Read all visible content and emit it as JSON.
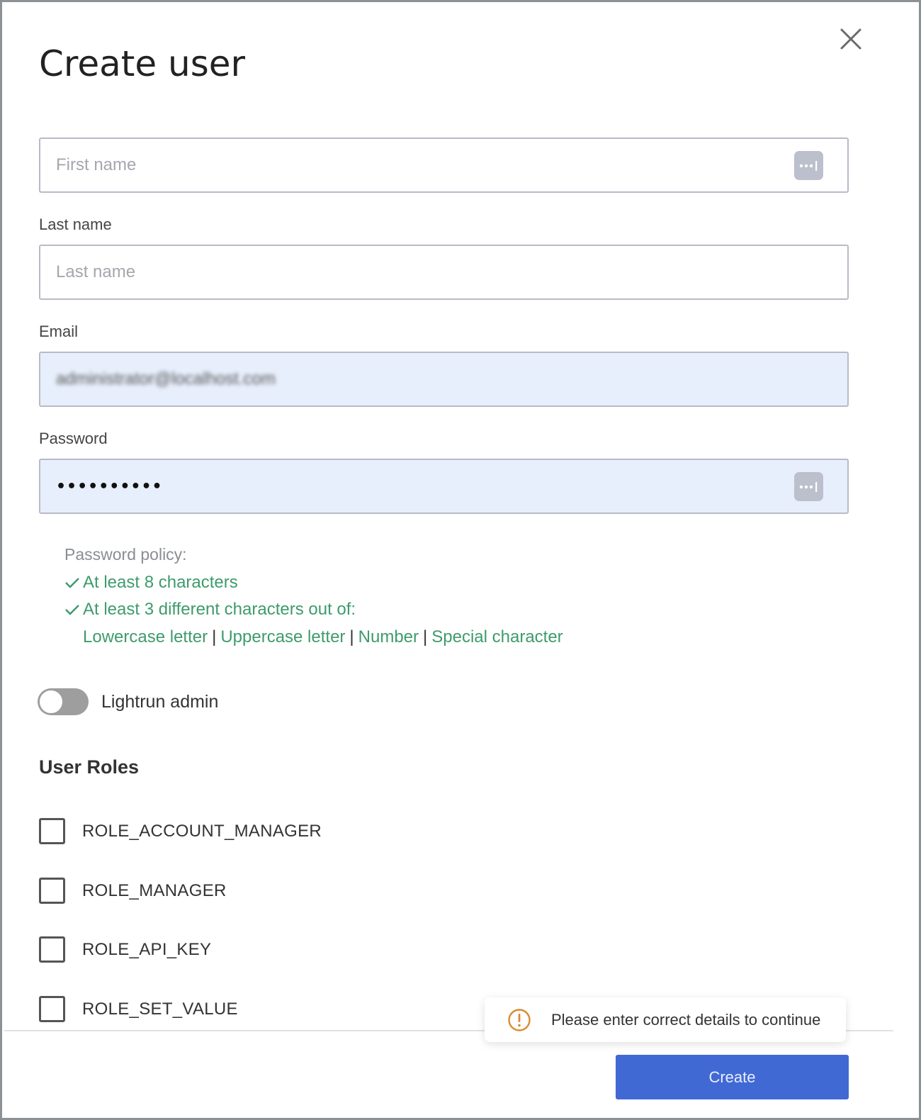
{
  "dialog": {
    "title": "Create user",
    "close_icon": "close-icon"
  },
  "fields": {
    "first_name": {
      "label": "",
      "placeholder": "First name",
      "value": ""
    },
    "last_name": {
      "label": "Last name",
      "placeholder": "Last name",
      "value": ""
    },
    "email": {
      "label": "Email",
      "value": "administrator@localhost.com"
    },
    "password": {
      "label": "Password",
      "value": "••••••••••"
    }
  },
  "password_policy": {
    "heading": "Password policy:",
    "rules": [
      {
        "text": "At least 8 characters",
        "satisfied": true
      },
      {
        "text": "At least 3 different characters out of:",
        "satisfied": true
      }
    ],
    "char_types": [
      "Lowercase letter",
      "Uppercase letter",
      "Number",
      "Special character"
    ],
    "separator": "|",
    "ok_color": "#3e9b6c"
  },
  "admin_toggle": {
    "label": "Lightrun admin",
    "on": false
  },
  "roles": {
    "title": "User Roles",
    "items": [
      {
        "label": "ROLE_ACCOUNT_MANAGER",
        "checked": false
      },
      {
        "label": "ROLE_MANAGER",
        "checked": false
      },
      {
        "label": "ROLE_API_KEY",
        "checked": false
      },
      {
        "label": "ROLE_SET_VALUE",
        "checked": false
      }
    ]
  },
  "toast": {
    "icon": "warning-circle-icon",
    "message": "Please enter correct details to continue",
    "color": "#d98b33"
  },
  "footer": {
    "create_label": "Create",
    "accent": "#4169d4"
  }
}
